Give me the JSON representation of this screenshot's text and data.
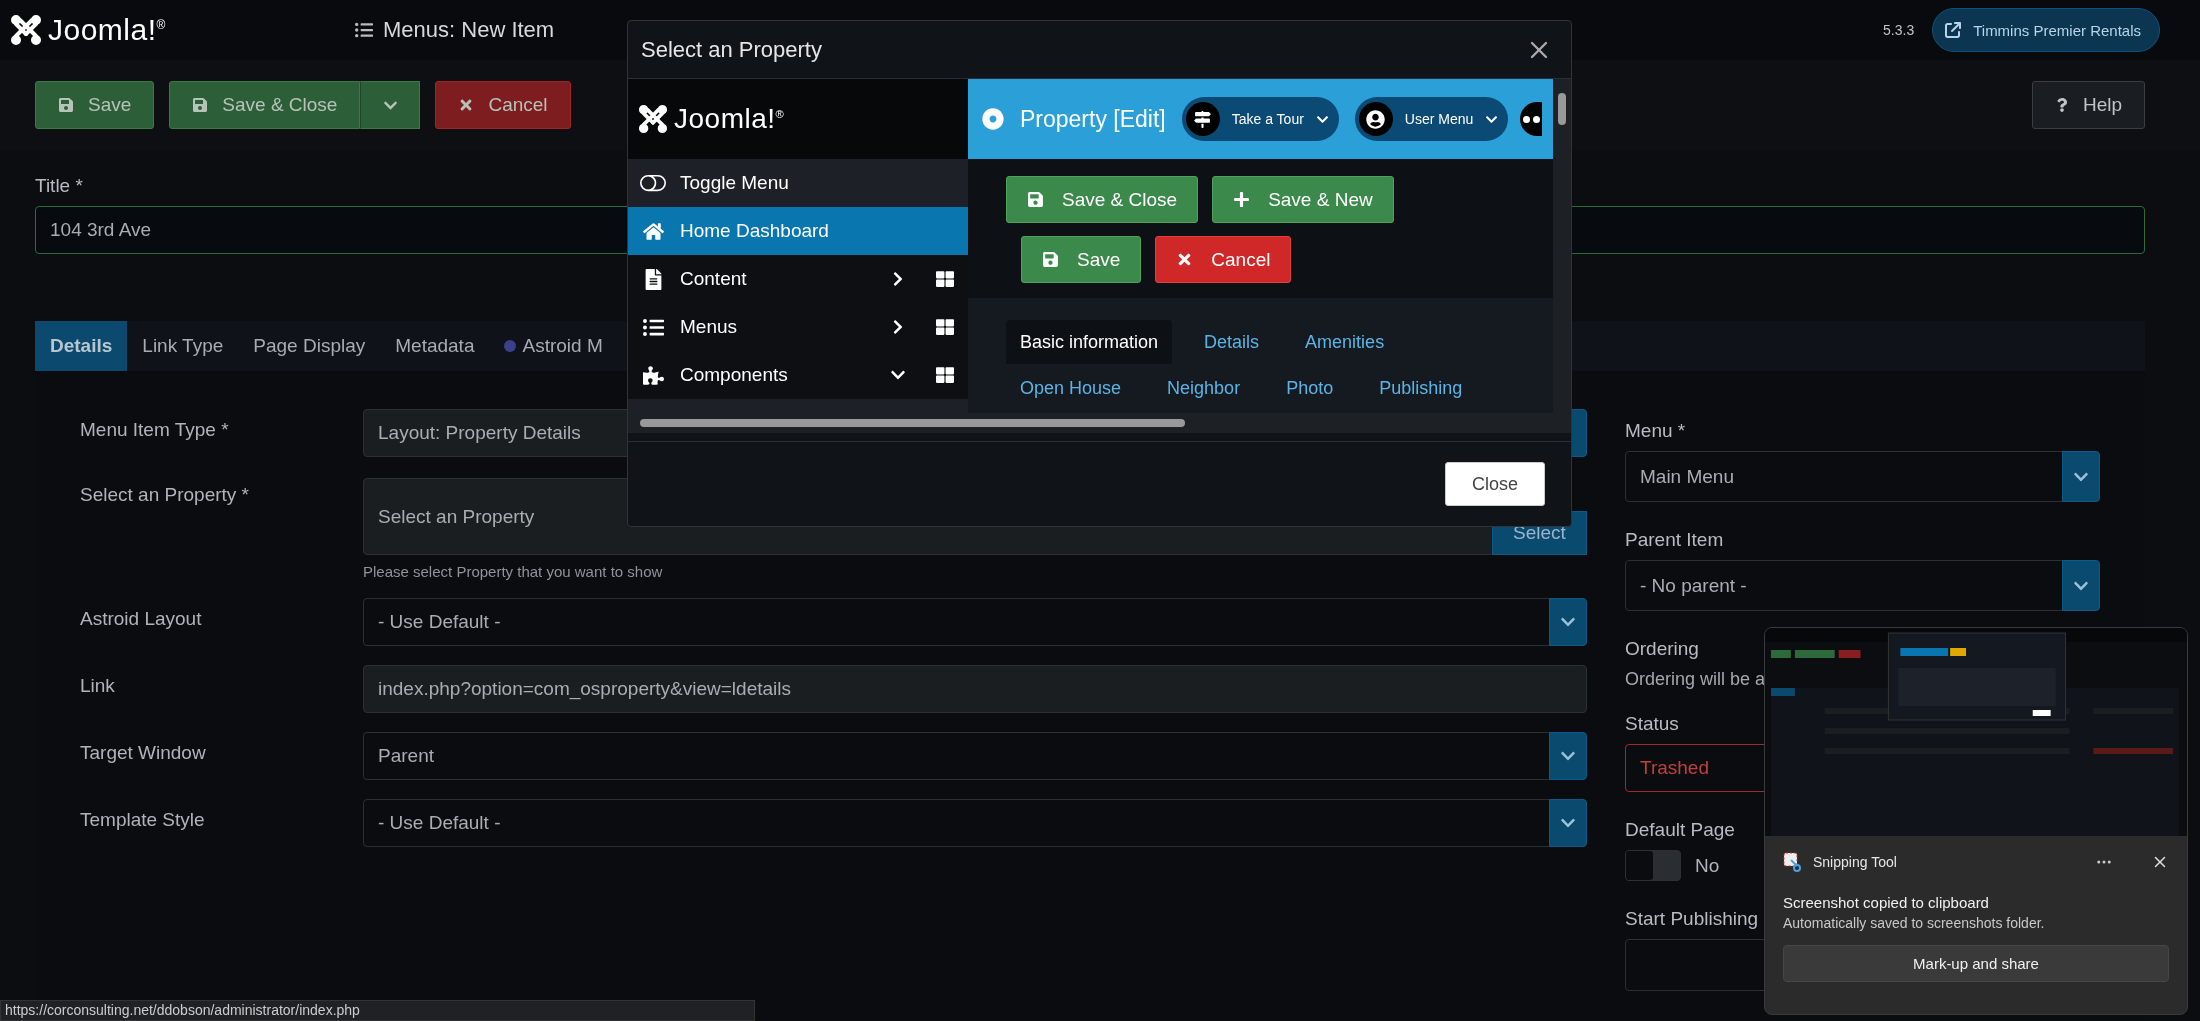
{
  "header": {
    "logo": "Joomla!$^{®}$",
    "title": "Menus: New Item",
    "version": "5.3.3",
    "site": "Timmins Premier Rentals"
  },
  "toolbar": {
    "buttons": [
      {
        "kind": "save",
        "label": "Save"
      },
      {
        "kind": "split",
        "label": "Save & Close"
      },
      {
        "kind": "cancel",
        "label": "Cancel"
      }
    ],
    "help": "Help"
  },
  "title_field": {
    "label": "Title *",
    "value": "104 3rd Ave"
  },
  "tabs": [
    {
      "kind": "plain",
      "label": "Details",
      "selected": true
    },
    {
      "kind": "plain",
      "label": "Link Type",
      "selected": false
    },
    {
      "kind": "plain",
      "label": "Page Display",
      "selected": false
    },
    {
      "kind": "plain",
      "label": "Metadata",
      "selected": false
    },
    {
      "kind": "dotted",
      "label": "Astroid M",
      "selected": false
    }
  ],
  "fields": [
    {
      "kind": "action",
      "label": "Menu Item Type *",
      "value": "Layout: Property Details"
    },
    {
      "kind": "picker",
      "label": "Select an Property *",
      "value": "Select an Property",
      "button": "Select",
      "hint": "Please select Property that you want to show"
    },
    {
      "kind": "select",
      "label": "Astroid Layout",
      "value": "- Use Default -"
    },
    {
      "kind": "readonly",
      "label": "Link",
      "value": "index.php?option=com_osproperty&view=ldetails"
    },
    {
      "kind": "select",
      "label": "Target Window",
      "value": "Parent"
    },
    {
      "kind": "select",
      "label": "Template Style",
      "value": "- Use Default -"
    }
  ],
  "options": [
    {
      "kind": "select",
      "label": "Menu *",
      "value": "Main Menu"
    },
    {
      "kind": "clearable",
      "label": "Parent Item",
      "value": "- No parent -"
    },
    {
      "kind": "note",
      "label": "Ordering",
      "value": "Ordering will be a"
    },
    {
      "kind": "status",
      "label": "Status",
      "value": "Trashed"
    },
    {
      "kind": "switch",
      "label": "Default Page",
      "on": false,
      "value": "No"
    },
    {
      "kind": "date",
      "label": "Start Publishing"
    }
  ],
  "modal": {
    "title": "Select an Property",
    "close": "Close",
    "frame": {
      "logo": "Joomla!$^{®}$",
      "sidebar": [
        {
          "kind": "toggle",
          "label": "Toggle Menu",
          "selected": false
        },
        {
          "kind": "link",
          "label": "Home Dashboard",
          "selected": true
        },
        {
          "kind": "group",
          "label": "Content",
          "selected": false,
          "expanded": false
        },
        {
          "kind": "group",
          "label": "Menus",
          "selected": false,
          "expanded": false
        },
        {
          "kind": "group",
          "label": "Components",
          "selected": false,
          "expanded": true
        }
      ],
      "heading": "Property [Edit]",
      "pills": [
        "Take a Tour",
        "User Menu"
      ],
      "buttons": [
        {
          "kind": "save_close",
          "label": "Save & Close"
        },
        {
          "kind": "new",
          "label": "Save & New"
        },
        {
          "kind": "save",
          "label": "Save"
        },
        {
          "kind": "cancel",
          "label": "Cancel"
        }
      ],
      "tabs": [
        {
          "label": "Basic information",
          "selected": true
        },
        {
          "label": "Details",
          "selected": false
        },
        {
          "label": "Amenities",
          "selected": false
        },
        {
          "label": "Open House",
          "selected": false
        },
        {
          "label": "Neighbor",
          "selected": false
        },
        {
          "label": "Photo",
          "selected": false
        },
        {
          "label": "Publishing",
          "selected": false
        }
      ]
    }
  },
  "toast": {
    "app": "Snipping Tool",
    "message": "Screenshot copied to clipboard",
    "detail": "Automatically saved to screenshots folder.",
    "action": "Mark-up and share"
  },
  "status_bar": {
    "url": "https://corconsulting.net/ddobson/administrator/index.php"
  }
}
